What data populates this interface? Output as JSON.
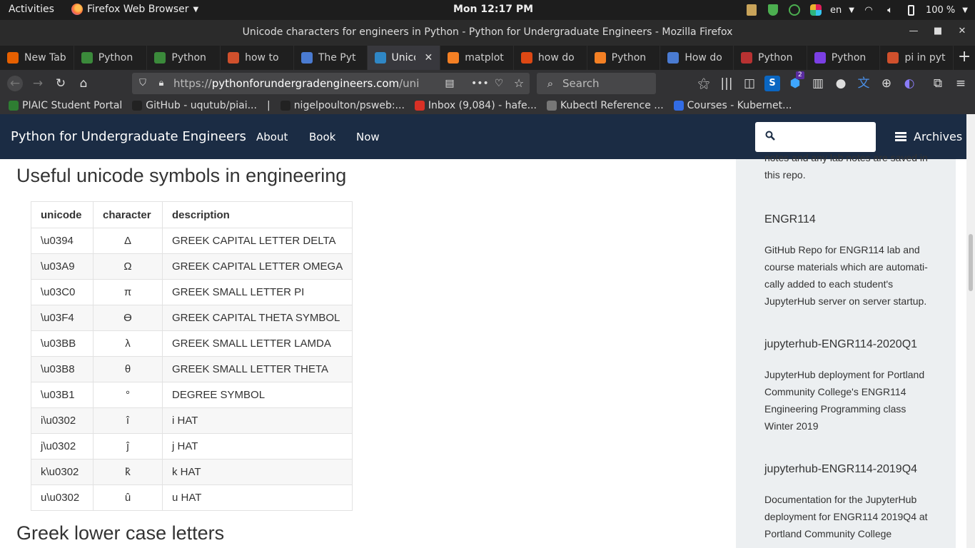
{
  "gnome": {
    "activities": "Activities",
    "app_menu": "Firefox Web Browser",
    "clock": "Mon 12:17 PM",
    "language": "en",
    "battery": "100 %"
  },
  "window": {
    "title": "Unicode characters for engineers in Python - Python for Undergraduate Engineers - Mozilla Firefox"
  },
  "tabs": [
    {
      "label": "New Tab",
      "color": "#e66000"
    },
    {
      "label": "Python",
      "color": "#3b8a3b"
    },
    {
      "label": "Python",
      "color": "#3b8a3b"
    },
    {
      "label": "how to",
      "color": "#d0502c"
    },
    {
      "label": "The Pyt",
      "color": "#4a7bd1"
    },
    {
      "label": "Unico",
      "color": "#2f87c6"
    },
    {
      "label": "matplot",
      "color": "#f48024"
    },
    {
      "label": "how do",
      "color": "#dd4814"
    },
    {
      "label": "Python",
      "color": "#f48024"
    },
    {
      "label": "How do",
      "color": "#4a7bd1"
    },
    {
      "label": "Python",
      "color": "#b83232"
    },
    {
      "label": "Python",
      "color": "#7b3fe4"
    },
    {
      "label": "pi in pyt",
      "color": "#d0502c"
    }
  ],
  "navbar": {
    "url_prefix": "https://",
    "url_host": "pythonforundergradengineers.com",
    "url_path": "/unic",
    "search_placeholder": "Search",
    "badge": "2"
  },
  "bookmarks": [
    {
      "label": "PIAIC Student Portal",
      "color": "#2e7d32"
    },
    {
      "label": "GitHub - uqutub/piai...",
      "color": "#222222"
    },
    {
      "label": "nigelpoulton/psweb:...",
      "color": "#222222"
    },
    {
      "label": "Inbox (9,084) - hafe...",
      "color": "#d93025"
    },
    {
      "label": "Kubectl Reference ...",
      "color": "#777777"
    },
    {
      "label": "Courses - Kubernet...",
      "color": "#326ce5"
    }
  ],
  "site": {
    "brand": "Python for Undergraduate Engineers",
    "links": [
      "About",
      "Book",
      "Now"
    ],
    "archives": "Archives"
  },
  "content": {
    "heading": "Useful unicode symbols in engineering",
    "heading2": "Greek lower case letters",
    "table": {
      "headers": [
        "unicode",
        "character",
        "description"
      ],
      "rows": [
        [
          "\\u0394",
          "Δ",
          "GREEK CAPITAL LETTER DELTA"
        ],
        [
          "\\u03A9",
          "Ω",
          "GREEK CAPITAL LETTER OMEGA"
        ],
        [
          "\\u03C0",
          "π",
          "GREEK SMALL LETTER PI"
        ],
        [
          "\\u03F4",
          "ϴ",
          "GREEK CAPITAL THETA SYMBOL"
        ],
        [
          "\\u03BB",
          "λ",
          "GREEK SMALL LETTER LAMDA"
        ],
        [
          "\\u03B8",
          "θ",
          "GREEK SMALL LETTER THETA"
        ],
        [
          "\\u03B1",
          "°",
          "DEGREE SYMBOL"
        ],
        [
          "i\\u0302",
          "î",
          "i HAT"
        ],
        [
          "j\\u0302",
          "ĵ",
          "j HAT"
        ],
        [
          "k\\u0302",
          "k̂",
          "k HAT"
        ],
        [
          "u\\u0302",
          "û",
          "u HAT"
        ]
      ]
    }
  },
  "sidebar": {
    "intro": "notes and any lab notes are saved in this repo.",
    "items": [
      {
        "title": "ENGR114",
        "desc": "GitHub Repo for ENGR114 lab and course materials which are automati­cally added to each student's JupyterHub server on server startup."
      },
      {
        "title": "jupyterhub-ENGR114-2020Q1",
        "desc": "JupyterHub deployment for Portland Community College's ENGR114 Engineering Programming class Winter 2019"
      },
      {
        "title": "jupyterhub-ENGR114-2019Q4",
        "desc": "Documentation for the JupyterHub deployment for ENGR114 2019Q4 at Portland Community College"
      }
    ]
  }
}
